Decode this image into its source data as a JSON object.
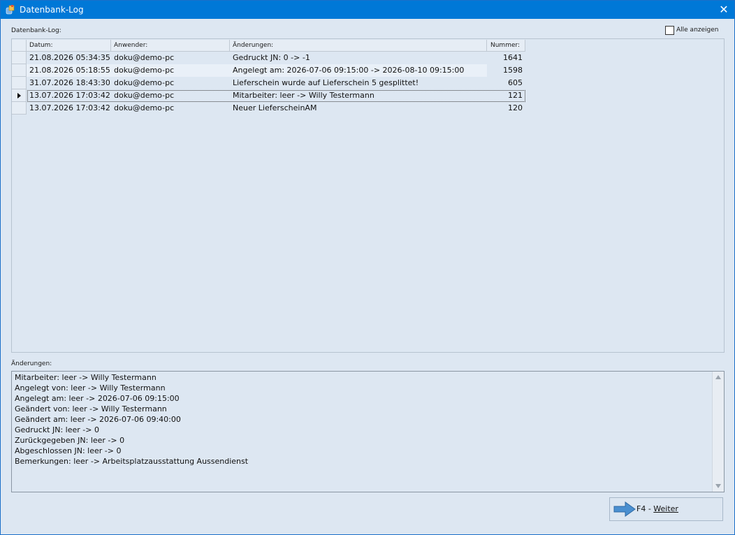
{
  "window": {
    "title": "Datenbank-Log",
    "close_glyph": "✕"
  },
  "grid": {
    "label": "Datenbank-Log:",
    "columns": [
      "Datum:",
      "Anwender:",
      "Änderungen:",
      "Nummer:"
    ],
    "rows": [
      {
        "datum": "21.08.2026 05:34:35",
        "anwender": "doku@demo-pc",
        "aenderung": "Gedruckt JN: 0 -> -1",
        "nummer": "1641"
      },
      {
        "datum": "21.08.2026 05:18:55",
        "anwender": "doku@demo-pc",
        "aenderung": "Angelegt am: 2026-07-06 09:15:00 -> 2026-08-10 09:15:00",
        "nummer": "1598"
      },
      {
        "datum": "31.07.2026 18:43:30",
        "anwender": "doku@demo-pc",
        "aenderung": "Lieferschein wurde auf Lieferschein 5 gesplittet!",
        "nummer": "605"
      },
      {
        "datum": "13.07.2026 17:03:42",
        "anwender": "doku@demo-pc",
        "aenderung": "Mitarbeiter: leer -> Willy Testermann",
        "nummer": "121"
      },
      {
        "datum": "13.07.2026 17:03:42",
        "anwender": "doku@demo-pc",
        "aenderung": "Neuer LieferscheinAM",
        "nummer": "120"
      }
    ],
    "selected_row": 3
  },
  "show_all": {
    "label": "Alle anzeigen",
    "checked": false
  },
  "details": {
    "label": "Änderungen:",
    "lines": [
      "Mitarbeiter: leer -> Willy Testermann",
      "Angelegt von: leer -> Willy Testermann",
      "Angelegt am: leer -> 2026-07-06 09:15:00",
      "Geändert von: leer -> Willy Testermann",
      "Geändert am: leer -> 2026-07-06 09:40:00",
      "Gedruckt JN: leer -> 0",
      "Zurückgegeben JN: leer -> 0",
      "Abgeschlossen JN: leer -> 0",
      "Bemerkungen: leer -> Arbeitsplatzausstattung Aussendienst"
    ]
  },
  "next_button": {
    "key": "F4 - ",
    "label": "Weiter"
  },
  "colors": {
    "titlebar": "#0078d7",
    "background": "#dde7f2",
    "button_arrow": "#4a8fd0"
  },
  "icons": {
    "app": "database-log-icon",
    "close": "close-icon",
    "next": "arrow-right-icon"
  }
}
